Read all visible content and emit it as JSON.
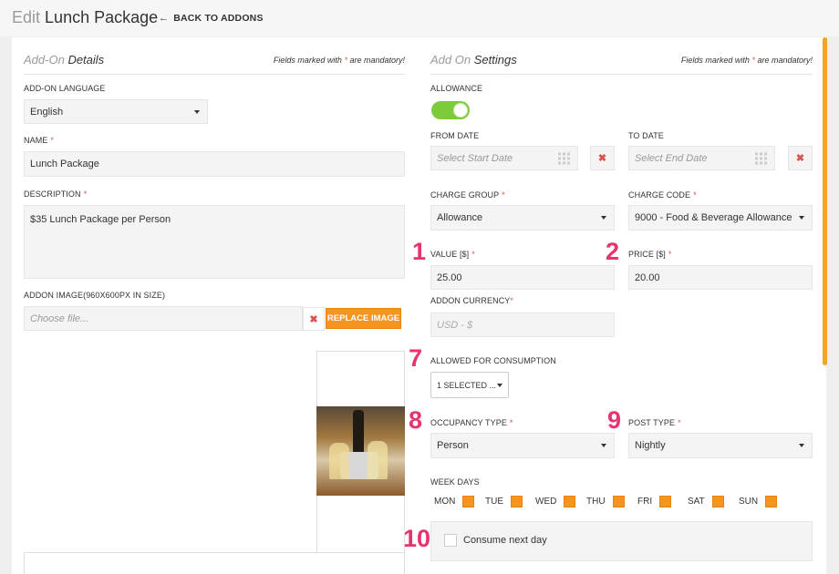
{
  "header": {
    "title_prefix": "Edit",
    "title": "Lunch Package",
    "back_label": "BACK TO ADDONS"
  },
  "details": {
    "section_title_prefix": "Add-On",
    "section_title": "Details",
    "note_prefix": "Fields marked with",
    "note_star": "*",
    "note_suffix": "are mandatory!",
    "language_label": "ADD-ON LANGUAGE",
    "language_value": "English",
    "name_label": "NAME",
    "name_value": "Lunch Package",
    "description_label": "DESCRIPTION",
    "description_value": "$35 Lunch Package per Person",
    "image_label": "ADDON IMAGE(960X600PX IN SIZE)",
    "image_placeholder": "Choose file...",
    "replace_image_label": "REPLACE IMAGE"
  },
  "settings": {
    "section_title_prefix": "Add On",
    "section_title": "Settings",
    "note_prefix": "Fields marked with",
    "note_star": "*",
    "note_suffix": "are mandatory!",
    "allowance_label": "ALLOWANCE",
    "allowance_on": true,
    "from_date_label": "FROM DATE",
    "from_date_placeholder": "Select Start Date",
    "to_date_label": "TO DATE",
    "to_date_placeholder": "Select End Date",
    "charge_group_label": "CHARGE GROUP",
    "charge_group_value": "Allowance",
    "charge_code_label": "CHARGE CODE",
    "charge_code_value": "9000 - Food & Beverage Allowance",
    "value_label": "VALUE [$]",
    "value_value": "25.00",
    "price_label": "PRICE [$]",
    "price_value": "20.00",
    "currency_label": "ADDON CURRENCY",
    "currency_value": "USD - $",
    "consumption_label": "ALLOWED FOR CONSUMPTION",
    "consumption_value": "1 SELECTED ...",
    "occupancy_label": "OCCUPANCY TYPE",
    "occupancy_value": "Person",
    "post_type_label": "POST TYPE",
    "post_type_value": "Nightly",
    "week_days_label": "WEEK DAYS",
    "days": [
      "MON",
      "TUE",
      "WED",
      "THU",
      "FRI",
      "SAT",
      "SUN"
    ],
    "consume_next_day_label": "Consume next day",
    "consume_next_day_checked": false
  },
  "markers": {
    "m1": "1",
    "m2": "2",
    "m7": "7",
    "m8": "8",
    "m9": "9",
    "m10": "10"
  },
  "colors": {
    "accent": "#f7941e",
    "toggle_on": "#7ccb3a",
    "required": "#d9534f",
    "marker": "#e8336e"
  },
  "icons": {
    "back": "arrow-left-icon",
    "clear": "close-icon",
    "calendar": "calendar-grid-icon",
    "dropdown": "chevron-down-icon"
  }
}
